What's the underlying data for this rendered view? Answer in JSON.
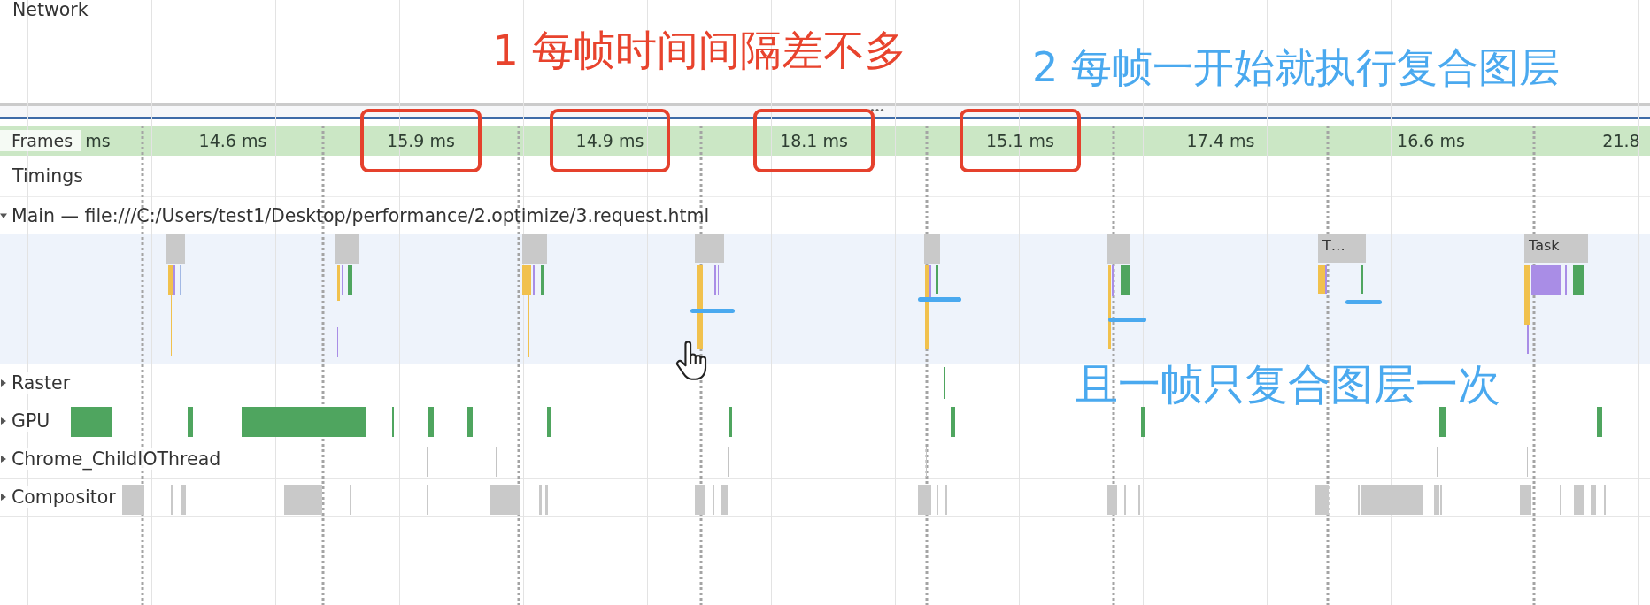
{
  "network_track": {
    "label": "Network"
  },
  "frames_track": {
    "label": "Frames",
    "frames": [
      {
        "duration": "ms",
        "highlighted": false
      },
      {
        "duration": "14.6 ms",
        "highlighted": false
      },
      {
        "duration": "15.9 ms",
        "highlighted": true
      },
      {
        "duration": "14.9 ms",
        "highlighted": true
      },
      {
        "duration": "18.1 ms",
        "highlighted": true
      },
      {
        "duration": "15.1 ms",
        "highlighted": true
      },
      {
        "duration": "17.4 ms",
        "highlighted": false
      },
      {
        "duration": "16.6 ms",
        "highlighted": false
      },
      {
        "duration": "21.8",
        "highlighted": false
      }
    ]
  },
  "timings_track": {
    "label": "Timings"
  },
  "thread_tracks": [
    {
      "kind": "main",
      "label": "Main — file:///C:/Users/test1/Desktop/performance/2.optimize/3.request.html",
      "expanded": true,
      "task_labels": [
        "T…",
        "Task"
      ]
    },
    {
      "kind": "raster",
      "label": "Raster",
      "expanded": false
    },
    {
      "kind": "gpu",
      "label": "GPU",
      "expanded": false
    },
    {
      "kind": "io",
      "label": "Chrome_ChildIOThread",
      "expanded": false
    },
    {
      "kind": "compositor",
      "label": "Compositor",
      "expanded": false
    }
  ],
  "annotations": [
    {
      "text": "1 每帧时间间隔差不多",
      "color": "#e8432d"
    },
    {
      "text": "2 每帧一开始就执行复合图层",
      "color": "#4aa9ef"
    },
    {
      "text": "且一帧只复合图层一次",
      "color": "#4aa9ef"
    }
  ]
}
